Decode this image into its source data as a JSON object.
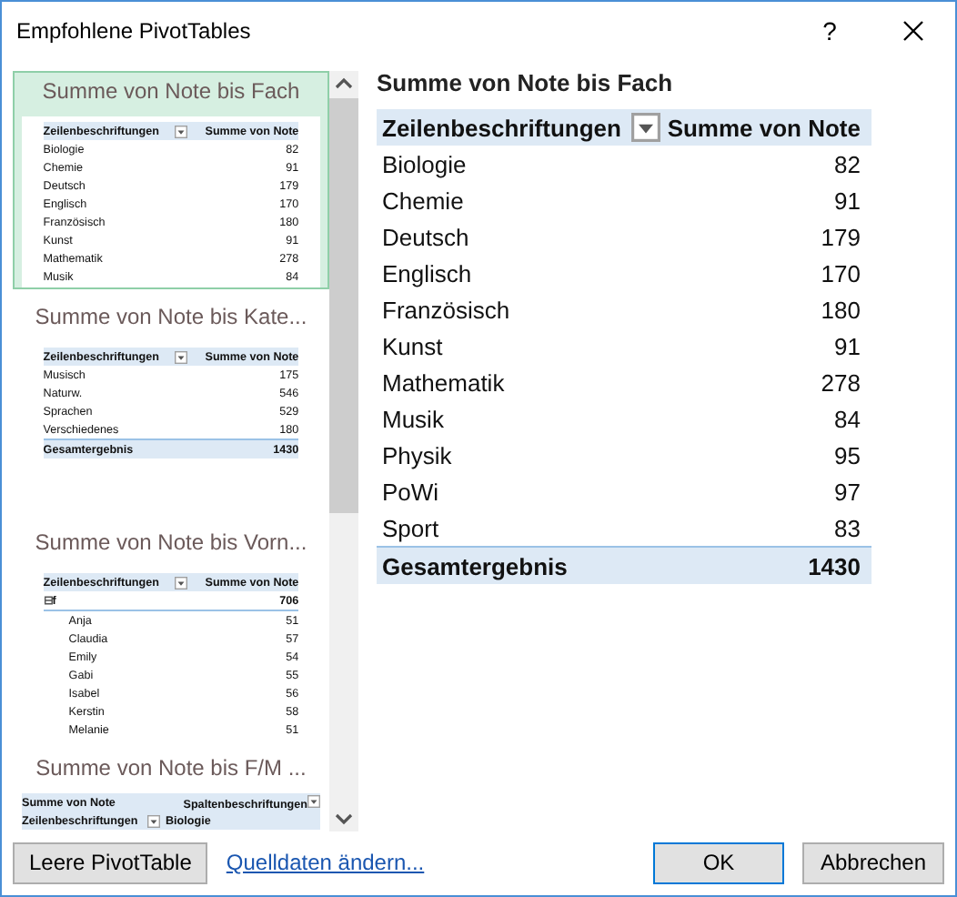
{
  "window": {
    "title": "Empfohlene PivotTables",
    "help": "?"
  },
  "recommendations": [
    {
      "title": "Summe von Note bis Fach",
      "selected": true,
      "kind": "rows",
      "columns": [
        "Zeilenbeschriftungen",
        "Summe von Note"
      ],
      "rows": [
        {
          "kind": "item",
          "label": "Biologie",
          "value": "82"
        },
        {
          "kind": "item",
          "label": "Chemie",
          "value": "91"
        },
        {
          "kind": "item",
          "label": "Deutsch",
          "value": "179"
        },
        {
          "kind": "item",
          "label": "Englisch",
          "value": "170"
        },
        {
          "kind": "item",
          "label": "Französisch",
          "value": "180"
        },
        {
          "kind": "item",
          "label": "Kunst",
          "value": "91"
        },
        {
          "kind": "item",
          "label": "Mathematik",
          "value": "278"
        },
        {
          "kind": "item",
          "label": "Musik",
          "value": "84"
        }
      ]
    },
    {
      "title": "Summe von Note bis Kate...",
      "selected": false,
      "kind": "rows",
      "columns": [
        "Zeilenbeschriftungen",
        "Summe von Note"
      ],
      "rows": [
        {
          "kind": "item",
          "label": "Musisch",
          "value": "175"
        },
        {
          "kind": "item",
          "label": "Naturw.",
          "value": "546"
        },
        {
          "kind": "item",
          "label": "Sprachen",
          "value": "529"
        },
        {
          "kind": "item",
          "label": "Verschiedenes",
          "value": "180"
        },
        {
          "kind": "total",
          "label": "Gesamtergebnis",
          "value": "1430"
        }
      ]
    },
    {
      "title": "Summe von Note bis Vorn...",
      "selected": false,
      "kind": "rows",
      "columns": [
        "Zeilenbeschriftungen",
        "Summe von Note"
      ],
      "rows": [
        {
          "kind": "group",
          "expander": "⊟",
          "label": "f",
          "value": "706"
        },
        {
          "kind": "child",
          "label": "Anja",
          "value": "51"
        },
        {
          "kind": "child",
          "label": "Claudia",
          "value": "57"
        },
        {
          "kind": "child",
          "label": "Emily",
          "value": "54"
        },
        {
          "kind": "child",
          "label": "Gabi",
          "value": "55"
        },
        {
          "kind": "child",
          "label": "Isabel",
          "value": "56"
        },
        {
          "kind": "child",
          "label": "Kerstin",
          "value": "58"
        },
        {
          "kind": "child",
          "label": "Melanie",
          "value": "51"
        }
      ]
    },
    {
      "title": "Summe von Note bis F/M ...",
      "selected": false,
      "kind": "crosstab",
      "columns": [
        "Summe von Note",
        "Spaltenbeschriftungen"
      ],
      "rows": [
        {
          "kind": "subheader",
          "label": "Zeilenbeschriftungen",
          "value": "Biologie"
        }
      ]
    }
  ],
  "preview": {
    "title": "Summe von Note bis Fach",
    "columns": [
      "Zeilenbeschriftungen",
      "Summe von Note"
    ],
    "rows": [
      {
        "kind": "item",
        "label": "Biologie",
        "value": "82"
      },
      {
        "kind": "item",
        "label": "Chemie",
        "value": "91"
      },
      {
        "kind": "item",
        "label": "Deutsch",
        "value": "179"
      },
      {
        "kind": "item",
        "label": "Englisch",
        "value": "170"
      },
      {
        "kind": "item",
        "label": "Französisch",
        "value": "180"
      },
      {
        "kind": "item",
        "label": "Kunst",
        "value": "91"
      },
      {
        "kind": "item",
        "label": "Mathematik",
        "value": "278"
      },
      {
        "kind": "item",
        "label": "Musik",
        "value": "84"
      },
      {
        "kind": "item",
        "label": "Physik",
        "value": "95"
      },
      {
        "kind": "item",
        "label": "PoWi",
        "value": "97"
      },
      {
        "kind": "item",
        "label": "Sport",
        "value": "83"
      },
      {
        "kind": "total",
        "label": "Gesamtergebnis",
        "value": "1430"
      }
    ]
  },
  "footer": {
    "empty_button": "Leere PivotTable",
    "source_link": "Quelldaten ändern...",
    "ok_button": "OK",
    "cancel_button": "Abbrechen"
  }
}
